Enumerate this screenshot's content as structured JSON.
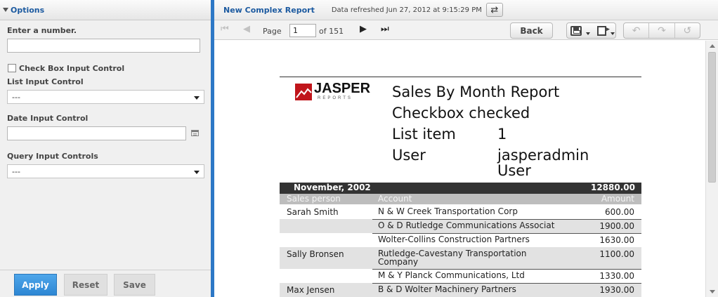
{
  "options": {
    "title": "Options",
    "number_label": "Enter a number.",
    "number_value": "",
    "checkbox_label": "Check Box Input Control",
    "list_label": "List Input Control",
    "list_value": "---",
    "date_label": "Date Input Control",
    "date_value": "",
    "query_label": "Query Input Controls",
    "query_value": "---",
    "apply_label": "Apply",
    "reset_label": "Reset",
    "save_label": "Save"
  },
  "report_view": {
    "title": "New Complex Report",
    "refreshed": "Data refreshed Jun 27, 2012 at 9:15:29 PM",
    "page_label": "Page",
    "page_value": "1",
    "of_label": "of 151",
    "back_label": "Back"
  },
  "report": {
    "logo_text": "JASPER",
    "logo_sub": "REPORTS",
    "title": "Sales By Month Report",
    "checkbox_line": "Checkbox checked",
    "list_key": "List item",
    "list_val": "1",
    "user_key": "User",
    "user_val1": "jasperadmin",
    "user_val2": "User",
    "month": "November, 2002",
    "month_total": "12880.00",
    "col_person": "Sales person",
    "col_account": "Account",
    "col_amount": "Amount",
    "rows": [
      {
        "person": "Sarah Smith",
        "account": "N & W Creek Transportation Corp",
        "amount": "600.00"
      },
      {
        "person": "",
        "account": "O & D Rutledge Communications Associat",
        "amount": "1900.00"
      },
      {
        "person": "",
        "account": "Wolter-Collins Construction Partners",
        "amount": "1630.00"
      },
      {
        "person": "Sally Bronsen",
        "account": "Rutledge-Cavestany Transportation Company",
        "amount": "1100.00"
      },
      {
        "person": "",
        "account": "M & Y Planck Communications, Ltd",
        "amount": "1330.00"
      },
      {
        "person": "Max Jensen",
        "account": "B & D Wolter Machinery Partners",
        "amount": "1930.00"
      }
    ]
  },
  "colors": {
    "accent": "#2d78c6",
    "link": "#1c5aa0",
    "apply": "#3a93dc",
    "logo_red": "#c0151b"
  }
}
